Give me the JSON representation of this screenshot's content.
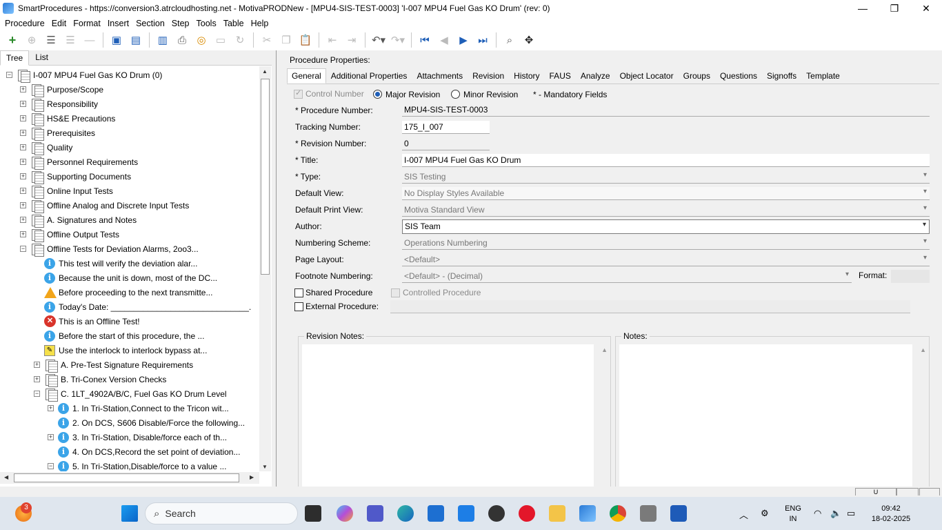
{
  "window": {
    "title": "SmartProcedures - https://conversion3.atrcloudhosting.net - MotivaPRODNew - [MPU4-SIS-TEST-0003] 'I-007 MPU4 Fuel Gas KO Drum' (rev: 0)",
    "minimize": "—",
    "maximize": "❐",
    "close": "✕"
  },
  "menu": [
    "Procedure",
    "Edit",
    "Format",
    "Insert",
    "Section",
    "Step",
    "Tools",
    "Table",
    "Help"
  ],
  "left_tabs": [
    "Tree",
    "List"
  ],
  "tree": [
    {
      "label": "I-007 MPU4 Fuel Gas KO Drum (0)",
      "icon": "doc",
      "exp": "−",
      "indent": 0
    },
    {
      "label": "Purpose/Scope",
      "icon": "doc",
      "exp": "+",
      "indent": 1
    },
    {
      "label": "Responsibility",
      "icon": "doc",
      "exp": "+",
      "indent": 1
    },
    {
      "label": "HS&E Precautions",
      "icon": "doc",
      "exp": "+",
      "indent": 1
    },
    {
      "label": "Prerequisites",
      "icon": "doc",
      "exp": "+",
      "indent": 1
    },
    {
      "label": "Quality",
      "icon": "doc",
      "exp": "+",
      "indent": 1
    },
    {
      "label": "Personnel Requirements",
      "icon": "doc",
      "exp": "+",
      "indent": 1
    },
    {
      "label": "Supporting Documents",
      "icon": "doc",
      "exp": "+",
      "indent": 1
    },
    {
      "label": "Online Input Tests",
      "icon": "doc",
      "exp": "+",
      "indent": 1
    },
    {
      "label": "Offline Analog and Discrete Input Tests",
      "icon": "doc",
      "exp": "+",
      "indent": 1
    },
    {
      "label": "A. Signatures and Notes",
      "icon": "doc",
      "exp": "+",
      "indent": 1
    },
    {
      "label": "Offline Output Tests",
      "icon": "doc",
      "exp": "+",
      "indent": 1
    },
    {
      "label": "Offline Tests for Deviation Alarms, 2oo3...",
      "icon": "doc",
      "exp": "−",
      "indent": 1
    },
    {
      "label": "This test will verify the deviation alar...",
      "icon": "info",
      "exp": "",
      "indent": 2
    },
    {
      "label": "Because the unit is down, most of the DC...",
      "icon": "info",
      "exp": "",
      "indent": 2
    },
    {
      "label": "Before proceeding to the next transmitte...",
      "icon": "warn",
      "exp": "",
      "indent": 2
    },
    {
      "label": "Today's Date: ______________________________.",
      "icon": "info",
      "exp": "",
      "indent": 2
    },
    {
      "label": "This is an Offline Test!",
      "icon": "err",
      "exp": "",
      "indent": 2
    },
    {
      "label": "Before the start of this procedure, the ...",
      "icon": "info",
      "exp": "",
      "indent": 2
    },
    {
      "label": "Use the interlock to interlock bypass at...",
      "icon": "note",
      "exp": "",
      "indent": 2
    },
    {
      "label": "A. Pre-Test Signature Requirements",
      "icon": "doc",
      "exp": "+",
      "indent": 2
    },
    {
      "label": "B. Tri-Conex Version Checks",
      "icon": "doc",
      "exp": "+",
      "indent": 2
    },
    {
      "label": "C. 1LT_4902A/B/C, Fuel Gas KO Drum Level",
      "icon": "doc",
      "exp": "−",
      "indent": 2
    },
    {
      "label": "1. In Tri-Station,Connect to the Tricon wit...",
      "icon": "info",
      "exp": "+",
      "indent": 3
    },
    {
      "label": "2. On DCS, S606 Disable/Force the following...",
      "icon": "info",
      "exp": "",
      "indent": 3
    },
    {
      "label": "3. In Tri-Station, Disable/force each of th...",
      "icon": "info",
      "exp": "+",
      "indent": 3
    },
    {
      "label": "4. On DCS,Record the set point of deviation...",
      "icon": "info",
      "exp": "",
      "indent": 3
    },
    {
      "label": "5. In Tri-Station,Disable/force to a value ...",
      "icon": "info",
      "exp": "−",
      "indent": 3
    }
  ],
  "props": {
    "header": "Procedure Properties:",
    "tabs": [
      "General",
      "Additional Properties",
      "Attachments",
      "Revision",
      "History",
      "FAUS",
      "Analyze",
      "Object Locator",
      "Groups",
      "Questions",
      "Signoffs",
      "Template"
    ],
    "control_number": "Control Number",
    "major_revision": "Major Revision",
    "minor_revision": "Minor Revision",
    "mandatory": "* - Mandatory Fields",
    "procedure_number_label": "* Procedure Number:",
    "procedure_number": "MPU4-SIS-TEST-0003",
    "tracking_number_label": "Tracking Number:",
    "tracking_number": "175_I_007",
    "revision_number_label": "* Revision Number:",
    "revision_number": "0",
    "title_label": "* Title:",
    "title": "I-007 MPU4 Fuel Gas KO Drum",
    "type_label": "* Type:",
    "type": "SIS Testing",
    "default_view_label": "Default View:",
    "default_view": "No Display Styles Available",
    "default_print_view_label": "Default Print View:",
    "default_print_view": "Motiva Standard View",
    "author_label": "Author:",
    "author": "SIS Team",
    "numbering_scheme_label": "Numbering Scheme:",
    "numbering_scheme": "Operations Numbering",
    "page_layout_label": "Page Layout:",
    "page_layout": "<Default>",
    "footnote_numbering_label": "Footnote Numbering:",
    "footnote_numbering": "<Default> - (Decimal)",
    "format_label": "Format:",
    "shared_procedure": "Shared Procedure",
    "controlled_procedure": "Controlled Procedure",
    "external_procedure": "External Procedure:",
    "revision_notes": "Revision Notes:",
    "notes": "Notes:"
  },
  "status_bar": {
    "cell1": "U"
  },
  "taskbar": {
    "search": "Search",
    "badge": "3",
    "lang_top": "ENG",
    "lang_bottom": "IN",
    "time": "09:42",
    "date": "18-02-2025"
  }
}
